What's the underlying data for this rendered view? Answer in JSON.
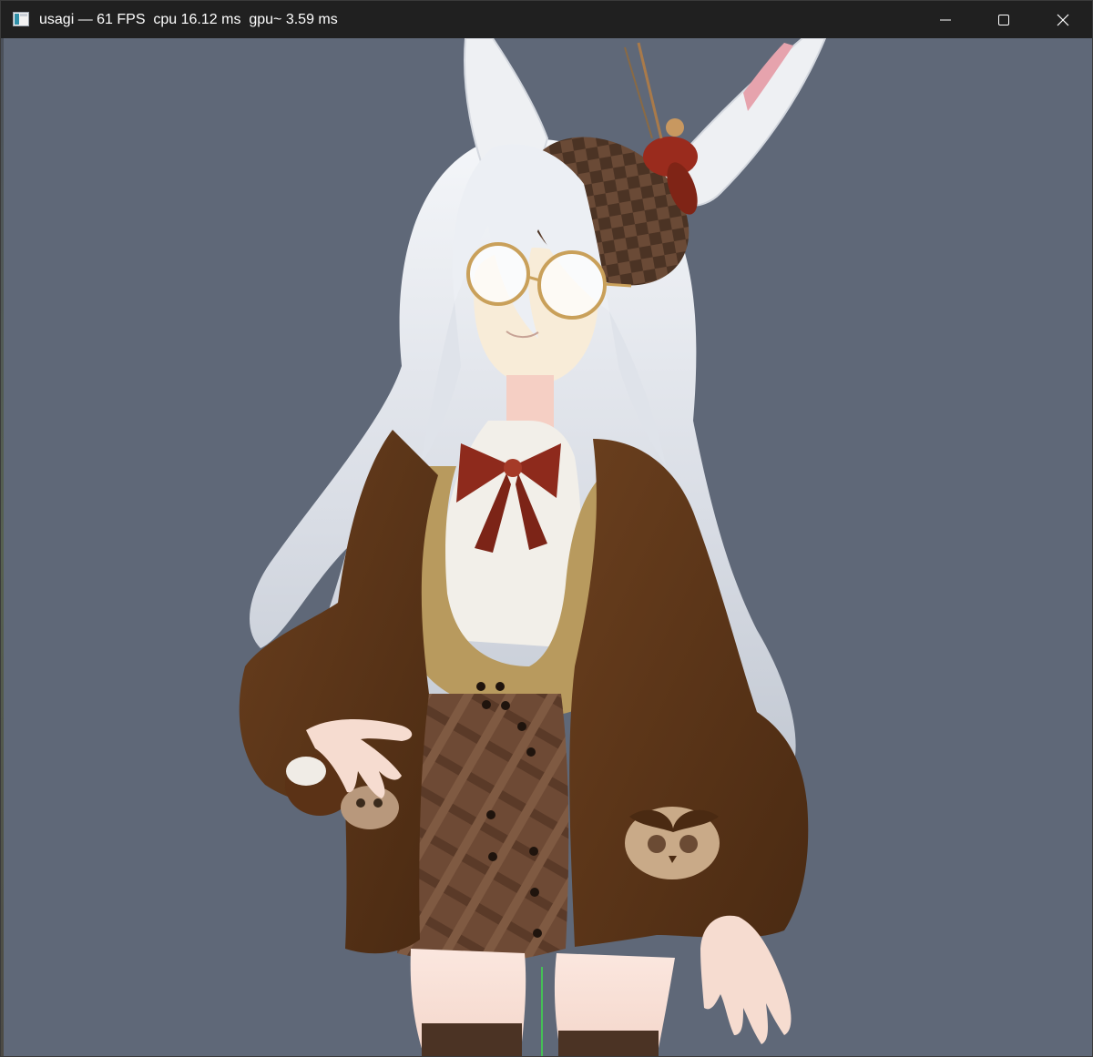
{
  "window": {
    "title": "usagi — 61 FPS  cpu 16.12 ms  gpu~ 3.59 ms",
    "app_icon": "app-window-icon",
    "controls": {
      "minimize": "minimize-icon",
      "maximize": "maximize-icon",
      "close": "close-icon"
    }
  },
  "viewport": {
    "background_color": "#5f6878",
    "axis_color": "#3ddc4a",
    "subject": "3d-avatar-model"
  },
  "colors": {
    "titlebar": "#202020",
    "hair": "#dfe3ea",
    "jacket": "#5a3418",
    "vest": "#b89a5e",
    "skirt": "#6e4a35",
    "bow": "#8e2a1c",
    "skin": "#f6dcd0",
    "glasses": "#c9a05a"
  }
}
